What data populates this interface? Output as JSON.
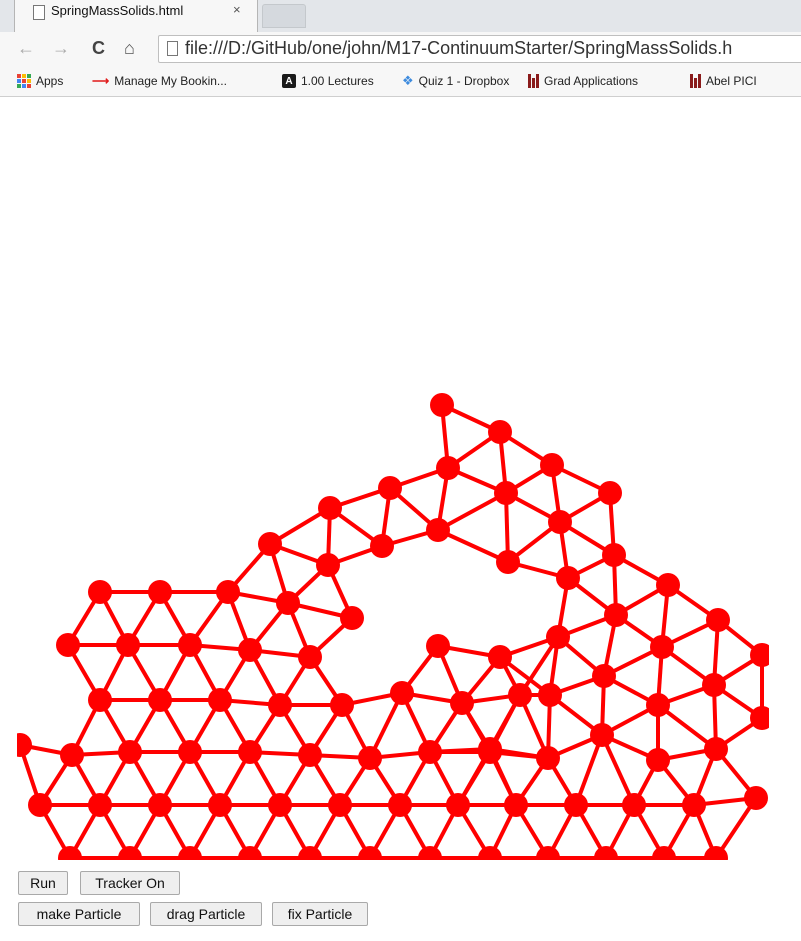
{
  "browser": {
    "tab_title": "SpringMassSolids.html",
    "tab_close": "×",
    "url": "file:///D:/GitHub/one/john/M17-ContinuumStarter/SpringMassSolids.h",
    "nav_icons": {
      "back": "←",
      "forward": "→",
      "reload": "C",
      "home": "⌂"
    }
  },
  "bookmarks": [
    {
      "label": "Apps",
      "icon": "apps-grid-icon"
    },
    {
      "label": "Manage My Bookin...",
      "icon": "airline-arrow-icon"
    },
    {
      "label": "1.00 Lectures",
      "icon": "a-icon"
    },
    {
      "label": "Quiz 1 - Dropbox",
      "icon": "dropbox-icon"
    },
    {
      "label": "Grad Applications",
      "icon": "mit-icon"
    },
    {
      "label": "Abel PICI",
      "icon": "mit-icon"
    }
  ],
  "simulation": {
    "particle_color": "#ff0000",
    "spring_color": "#ff0000"
  },
  "controls": {
    "row1": [
      {
        "label": "Run"
      },
      {
        "label": "Tracker On"
      }
    ],
    "row2": [
      {
        "label": "make Particle"
      },
      {
        "label": "drag Particle"
      },
      {
        "label": "fix Particle"
      }
    ]
  }
}
